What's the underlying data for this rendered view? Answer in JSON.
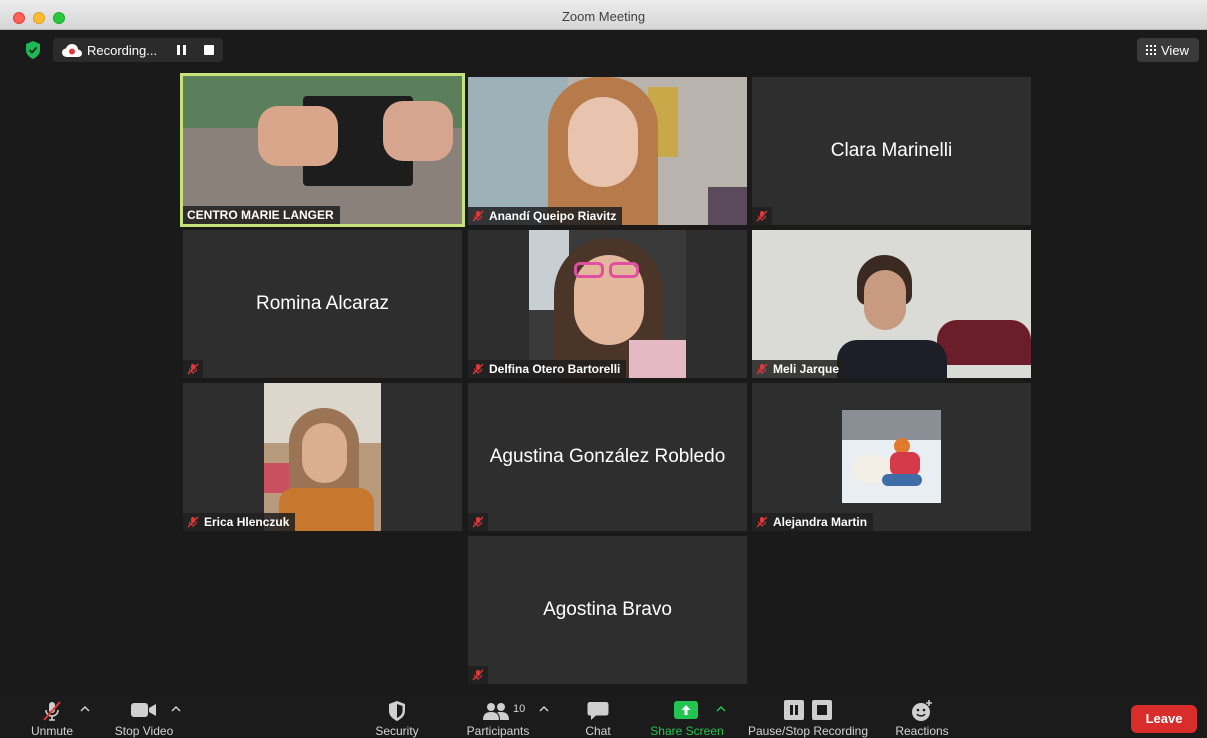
{
  "window": {
    "title": "Zoom Meeting"
  },
  "recording": {
    "label": "Recording..."
  },
  "view_button": {
    "label": "View"
  },
  "participants": [
    {
      "name": "CENTRO MARIE LANGER",
      "video": true,
      "active_speaker": true,
      "muted": false
    },
    {
      "name": "Anandí Queipo Riavitz",
      "video": true,
      "muted": true
    },
    {
      "name": "Clara Marinelli",
      "video": false,
      "muted": true
    },
    {
      "name": "Romina Alcaraz",
      "video": false,
      "muted": true
    },
    {
      "name": "Delfina Otero Bartorelli",
      "video": true,
      "muted": true
    },
    {
      "name": "Meli Jarque",
      "video": true,
      "muted": true
    },
    {
      "name": "Erica Hlenczuk",
      "video": true,
      "muted": true
    },
    {
      "name": "Agustina González Robledo",
      "video": false,
      "muted": true
    },
    {
      "name": "Alejandra Martin",
      "video": true,
      "muted": true
    },
    {
      "name": "Agostina Bravo",
      "video": false,
      "muted": true
    }
  ],
  "toolbar": {
    "unmute": "Unmute",
    "stop_video": "Stop Video",
    "security": "Security",
    "participants": "Participants",
    "participants_count": "10",
    "chat": "Chat",
    "share_screen": "Share Screen",
    "pause_stop_recording": "Pause/Stop Recording",
    "reactions": "Reactions",
    "leave": "Leave"
  },
  "colors": {
    "active_speaker_border": "#c6e27b",
    "share_screen_green": "#23c552",
    "leave_red": "#d92d2b",
    "mute_red": "#e0373b",
    "security_green": "#1db954"
  }
}
